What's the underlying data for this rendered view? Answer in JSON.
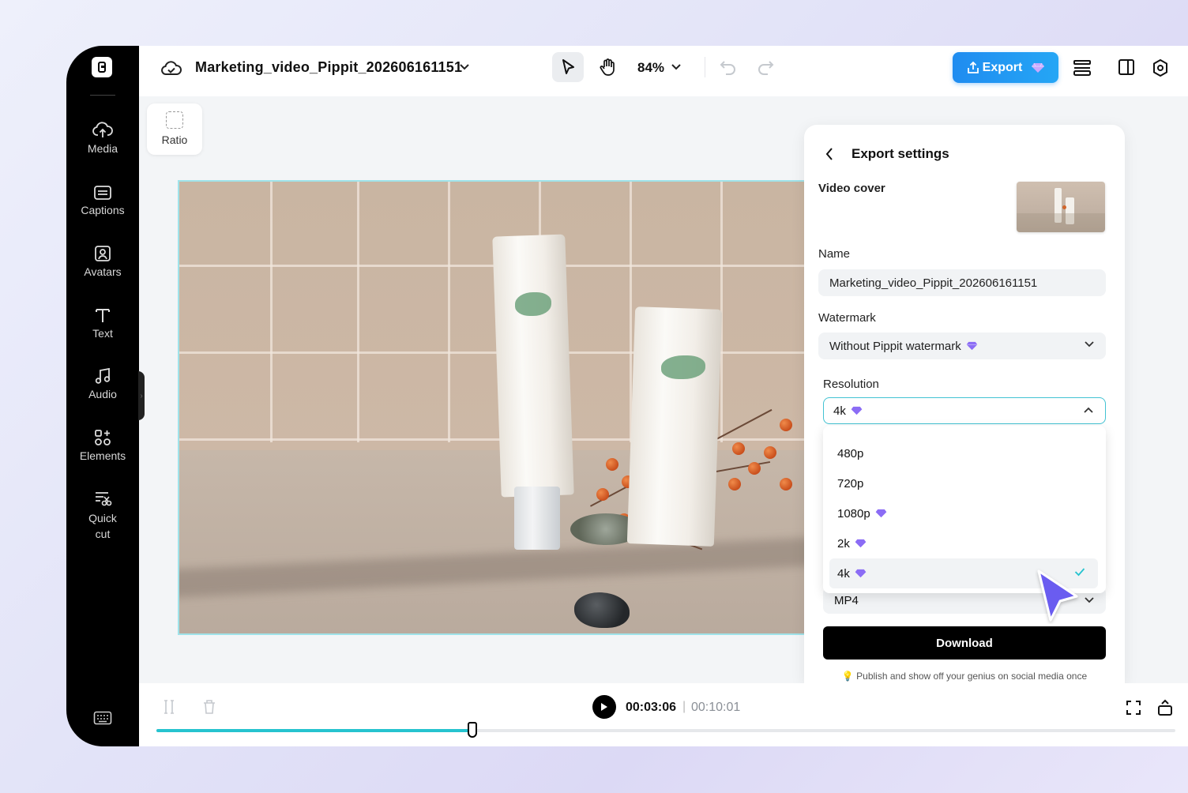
{
  "topbar": {
    "project_title": "Marketing_video_Pippit_202606161151",
    "zoom": "84%",
    "export_label": "Export"
  },
  "sidebar": {
    "items": [
      {
        "label": "Media",
        "icon": "cloud-upload-icon"
      },
      {
        "label": "Captions",
        "icon": "captions-icon"
      },
      {
        "label": "Avatars",
        "icon": "avatar-icon"
      },
      {
        "label": "Text",
        "icon": "text-icon"
      },
      {
        "label": "Audio",
        "icon": "music-icon"
      },
      {
        "label": "Elements",
        "icon": "elements-icon"
      },
      {
        "label": "Quick",
        "label2": "cut",
        "icon": "quick-cut-icon"
      }
    ]
  },
  "canvas": {
    "ratio_label": "Ratio"
  },
  "export_panel": {
    "title": "Export settings",
    "video_cover_label": "Video cover",
    "name_label": "Name",
    "name_value": "Marketing_video_Pippit_202606161151",
    "watermark_label": "Watermark",
    "watermark_value": "Without Pippit watermark",
    "resolution_label": "Resolution",
    "resolution_value": "4k",
    "resolution_options": [
      {
        "label": "480p",
        "premium": false
      },
      {
        "label": "720p",
        "premium": false
      },
      {
        "label": "1080p",
        "premium": true
      },
      {
        "label": "2k",
        "premium": true
      },
      {
        "label": "4k",
        "premium": true,
        "selected": true
      }
    ],
    "format_value": "MP4",
    "download_label": "Download",
    "tip": "Publish and show off your genius on social media once downloaded."
  },
  "timeline": {
    "current_time": "00:03:06",
    "separator": "|",
    "total_time": "00:10:01",
    "progress": 0.31
  },
  "colors": {
    "accent": "#26c3cf",
    "export_button": "#1f8cf0",
    "premium_gem": "#8b6cf5",
    "cursor": "#6b5cf0"
  }
}
